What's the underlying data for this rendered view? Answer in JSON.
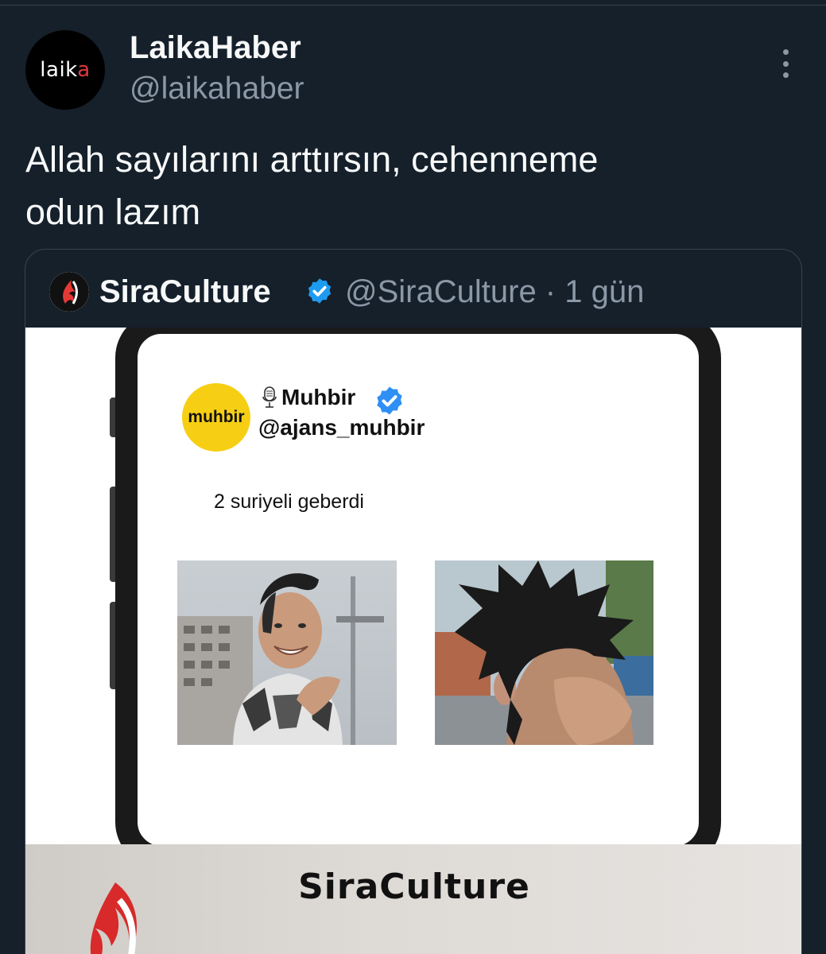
{
  "author": {
    "avatar_text_main": "laik",
    "avatar_text_accent": "a",
    "display_name": "LaikaHaber",
    "handle": "@laikahaber"
  },
  "tweet": {
    "text_line1": "Allah sayılarını arttırsın, cehenneme",
    "text_line2": "odun lazım"
  },
  "quoted": {
    "display_name": "SiraCulture",
    "meta": "@SiraCulture · 1 gün",
    "media": {
      "inner_author_logo_text": "muhbir",
      "inner_author_name": "Muhbir",
      "inner_author_handle": "@ajans_muhbir",
      "inner_post_text": "2 suriyeli geberdi",
      "banner_brand": "SiraCulture"
    }
  },
  "colors": {
    "background": "#15202b",
    "secondary_text": "#8b98a5",
    "verified": "#1d9bf0",
    "muhbir_yellow": "#f6cf15",
    "laika_accent": "#e2383f"
  },
  "icons": [
    "more-icon",
    "verified-badge-icon",
    "microphone-icon",
    "siraculture-logo-icon"
  ]
}
